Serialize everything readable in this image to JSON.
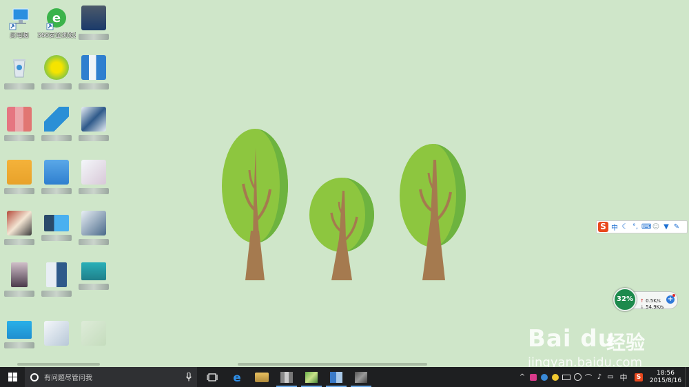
{
  "desktop": {
    "icons": [
      {
        "label": "此电脑"
      },
      {
        "label": "360安全浏览器"
      }
    ]
  },
  "ime": {
    "logo": "S",
    "mode": "中",
    "items": [
      "moon-icon",
      "punct-icon",
      "keyboard-icon",
      "user-icon",
      "skin-icon",
      "tools-icon"
    ]
  },
  "net": {
    "percent": "32%",
    "up": "0.5K/s",
    "down": "54.9K/s",
    "plus": "+"
  },
  "watermark": {
    "brand": "Bai du",
    "subtitle": "经验",
    "url": "jingyan.baidu.com"
  },
  "taskbar": {
    "search_placeholder": "有问题尽管问我",
    "ime_indicator": "中",
    "time": "18:56",
    "date": "2015/8/16"
  },
  "colors": {
    "desktop_bg": "#cfe6c9",
    "tree_light": "#8dc63f",
    "tree_dark": "#6db33f",
    "trunk": "#a57a4f",
    "taskbar": "#1e1f21"
  }
}
